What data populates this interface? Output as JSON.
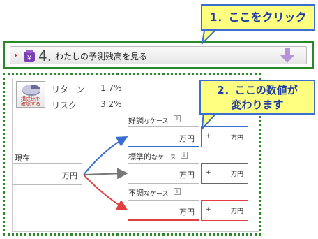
{
  "callouts": {
    "step1": "1．ここをクリック",
    "step2_line1": "2．ここの数値が",
    "step2_line2": "変わります"
  },
  "section": {
    "number": "4.",
    "title": "わたしの予測残高を見る"
  },
  "portfolio": {
    "button_label_1": "構成比を",
    "button_label_2": "確認する",
    "return_label": "リターン",
    "return_value": "1.7%",
    "risk_label": "リスク",
    "risk_value": "3.2%"
  },
  "current": {
    "label": "現在",
    "unit": "万円"
  },
  "cases": [
    {
      "label_main": "好調",
      "label_sub": "なケース",
      "unit": "万円",
      "delta_prefix": "+",
      "delta_unit": "万円"
    },
    {
      "label_main": "標準的",
      "label_sub": "なケース",
      "unit": "万円",
      "delta_prefix": "+",
      "delta_unit": "万円"
    },
    {
      "label_main": "不調",
      "label_sub": "なケース",
      "unit": "万円",
      "delta_prefix": "+",
      "delta_unit": "万円"
    }
  ],
  "info_icon_glyph": "i",
  "colors": {
    "callout_bg": "#ffff80",
    "callout_border": "#3a6fd1",
    "section_border": "#2a8a2a",
    "good": "#3a6fd1",
    "bad": "#e04040",
    "mid": "#666666"
  },
  "icons": {
    "badge": "yen-purse-icon",
    "expand": "down-arrow-icon",
    "portfolio": "pie-chart-icon",
    "info": "info-icon"
  }
}
